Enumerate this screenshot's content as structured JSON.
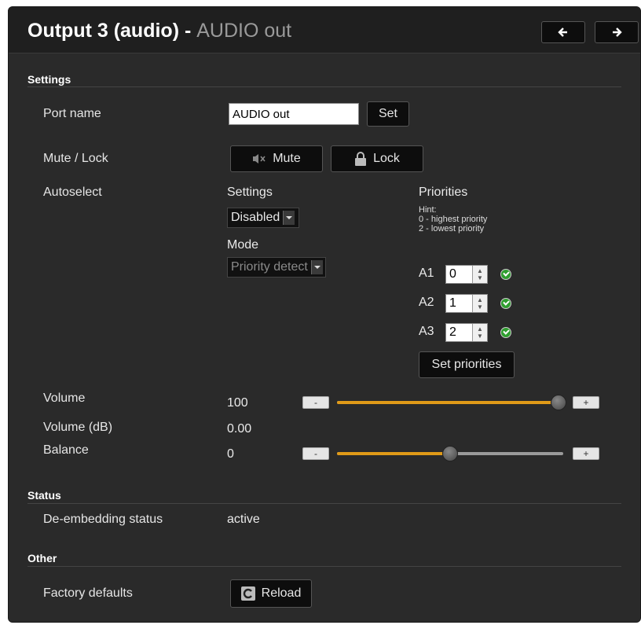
{
  "header": {
    "title_main": "Output 3 (audio) - ",
    "title_sub": "AUDIO out",
    "prev_icon": "arrow-left-icon",
    "next_icon": "arrow-right-icon"
  },
  "settings": {
    "section_title": "Settings",
    "port_name": {
      "label": "Port name",
      "value": "AUDIO out",
      "set_label": "Set"
    },
    "mute_lock": {
      "label": "Mute / Lock",
      "mute_label": "Mute",
      "lock_label": "Lock",
      "mute_icon": "speaker-mute-icon",
      "lock_icon": "lock-icon"
    },
    "autoselect": {
      "label": "Autoselect",
      "settings_label": "Settings",
      "settings_value": "Disabled",
      "mode_label": "Mode",
      "mode_value": "Priority detect",
      "priorities_label": "Priorities",
      "hint_lines": [
        "Hint:",
        "0 - highest priority",
        "2 - lowest priority"
      ],
      "priorities": [
        {
          "name": "A1",
          "value": "0"
        },
        {
          "name": "A2",
          "value": "1"
        },
        {
          "name": "A3",
          "value": "2"
        }
      ],
      "set_priorities_label": "Set priorities"
    },
    "volume": {
      "label": "Volume",
      "value": "100",
      "level_fraction": 1.0,
      "minus": "-",
      "plus": "+"
    },
    "volume_db": {
      "label": "Volume (dB)",
      "value": "0.00"
    },
    "balance": {
      "label": "Balance",
      "value": "0",
      "level_fraction": 0.5,
      "minus": "-",
      "plus": "+"
    }
  },
  "status": {
    "section_title": "Status",
    "deembedding": {
      "label": "De-embedding status",
      "value": "active"
    }
  },
  "other": {
    "section_title": "Other",
    "factory": {
      "label": "Factory defaults",
      "reload_label": "Reload",
      "reload_icon": "reload-icon"
    }
  },
  "colors": {
    "accent": "#e09a18",
    "background": "#2a2a2a",
    "ok": "#2f9e2f"
  }
}
